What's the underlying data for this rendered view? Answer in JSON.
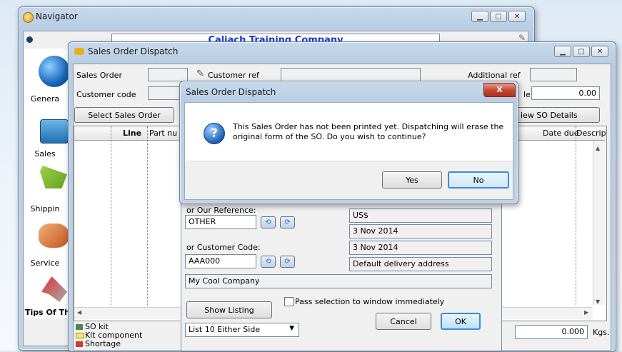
{
  "navigator": {
    "title": "Navigator",
    "company": "Caliach Training Company",
    "sidebar": [
      {
        "label": "Genera",
        "icon": "globe-icon"
      },
      {
        "label": "Sales",
        "icon": "sales-icon"
      },
      {
        "label": "Shippin",
        "icon": "shipping-cart-icon"
      },
      {
        "label": "Service",
        "icon": "handshake-icon"
      },
      {
        "label": "",
        "icon": "tools-icon"
      }
    ],
    "tips": "Tips Of Th"
  },
  "dispatch": {
    "title": "Sales Order Dispatch",
    "sales_order_label": "Sales Order",
    "customer_code_label": "Customer code",
    "customer_ref_label": "Customer ref",
    "additional_ref_label": "Additional ref",
    "value_suffix_label": "le",
    "value": "0.00",
    "select_button": "Select Sales Order",
    "view_button": "iew SO Details",
    "columns": {
      "line": "Line",
      "part": "Part nu",
      "due": "Date due",
      "desc": "Descrip"
    },
    "legend": [
      "SO kit",
      "Kit component",
      "Shortage"
    ],
    "weight": "0.000",
    "weight_unit": "Kgs."
  },
  "picker": {
    "our_ref_label": "or Our Reference:",
    "our_ref_value": "OTHER",
    "cust_code_label": "or Customer Code:",
    "cust_code_value": "AAA000",
    "company_name": "My Cool Company",
    "currency": "US$",
    "date1": "3 Nov 2014",
    "date2": "3 Nov 2014",
    "address": "Default delivery address",
    "pass_selection_label": "Pass selection to window immediately",
    "show_listing": "Show Listing",
    "list_option": "List 10 Either Side",
    "cancel": "Cancel",
    "ok": "OK"
  },
  "dialog": {
    "title": "Sales Order Dispatch",
    "message": "This Sales Order has not been printed yet. Dispatching will erase the original form of the SO. Do you wish to continue?",
    "yes": "Yes",
    "no": "No",
    "close": "X"
  }
}
